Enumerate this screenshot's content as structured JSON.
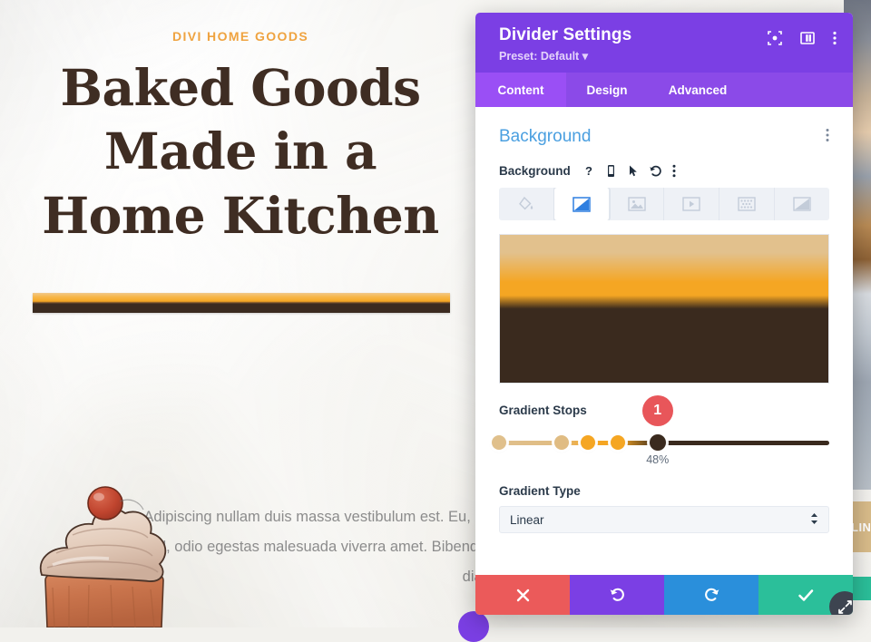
{
  "page": {
    "eyebrow": "DIVI HOME GOODS",
    "heading": "Baked Goods Made in a Home Kitchen",
    "paragraph": "Adipiscing nullam duis massa vestibulum est. Eu, hac nisl, odio egestas malesuada viverra amet. Bibendum diam.",
    "right_cta_label": "LINK",
    "divider_gradient_start": "#f5a623",
    "divider_gradient_end": "#3b2b20",
    "eyebrow_color": "#efa340",
    "heading_color": "#3f2d23",
    "cupcake_icon": "cupcake-illustration"
  },
  "panel": {
    "title": "Divider Settings",
    "preset": "Preset: Default",
    "accent_color": "#7b3fe4",
    "header_icons": [
      {
        "name": "focus-target-icon"
      },
      {
        "name": "panel-layout-icon"
      },
      {
        "name": "kebab-menu-icon"
      }
    ],
    "tabs": [
      {
        "label": "Content",
        "active": true
      },
      {
        "label": "Design",
        "active": false
      },
      {
        "label": "Advanced",
        "active": false
      }
    ],
    "section": {
      "title": "Background",
      "title_color": "#4a9fe0",
      "options_icon": "kebab-menu-icon"
    },
    "field": {
      "label": "Background",
      "icons": [
        {
          "name": "help-icon"
        },
        {
          "name": "responsive-mobile-icon"
        },
        {
          "name": "hover-cursor-icon"
        },
        {
          "name": "reset-undo-icon"
        },
        {
          "name": "kebab-menu-icon"
        }
      ]
    },
    "background_types": [
      {
        "name": "background-color-tab",
        "icon": "paint-bucket-icon",
        "active": false
      },
      {
        "name": "background-gradient-tab",
        "icon": "gradient-icon",
        "active": true
      },
      {
        "name": "background-image-tab",
        "icon": "image-icon",
        "active": false
      },
      {
        "name": "background-video-tab",
        "icon": "video-icon",
        "active": false
      },
      {
        "name": "background-pattern-tab",
        "icon": "pattern-icon",
        "active": false
      },
      {
        "name": "background-mask-tab",
        "icon": "mask-icon",
        "active": false
      }
    ],
    "gradient": {
      "preview_colors": [
        "#e2c18d",
        "#f5a623",
        "#3a2a1e"
      ],
      "stops_label": "Gradient Stops",
      "selected_index": 1,
      "selected_badge": "1",
      "selected_percent": "48%",
      "stops": [
        {
          "color": "#e0c08c",
          "position": 0,
          "selected": false
        },
        {
          "color": "#e0bc83",
          "position": 19,
          "selected": false
        },
        {
          "color": "#f5a623",
          "position": 27,
          "selected": false
        },
        {
          "color": "#f5a623",
          "position": 36,
          "selected": false
        },
        {
          "color": "#3a2a1e",
          "position": 48,
          "selected": true
        }
      ],
      "type_label": "Gradient Type",
      "type_value": "Linear"
    },
    "footer": [
      {
        "name": "cancel-button",
        "icon": "close-x-icon",
        "color": "#eb5a5a"
      },
      {
        "name": "undo-button",
        "icon": "undo-icon",
        "color": "#7b3fe4"
      },
      {
        "name": "redo-button",
        "icon": "redo-icon",
        "color": "#2a8fdb"
      },
      {
        "name": "save-button",
        "icon": "checkmark-icon",
        "color": "#2bbf9a"
      }
    ],
    "resize_handle_icon": "resize-diagonal-icon"
  }
}
